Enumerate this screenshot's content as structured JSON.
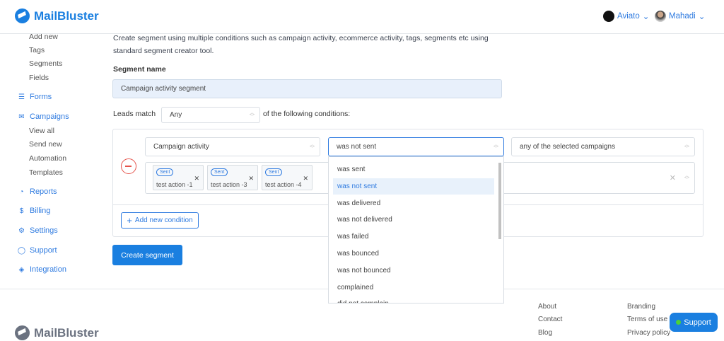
{
  "header": {
    "brand": "MailBluster",
    "accounts": [
      {
        "name": "Aviato"
      },
      {
        "name": "Mahadi"
      }
    ]
  },
  "sidebar": {
    "lead_sub": [
      "Add new",
      "Tags",
      "Segments",
      "Fields"
    ],
    "forms": "Forms",
    "campaigns": {
      "label": "Campaigns",
      "items": [
        "View all",
        "Send new",
        "Automation",
        "Templates"
      ]
    },
    "items": [
      "Reports",
      "Billing",
      "Settings",
      "Support",
      "Integration"
    ]
  },
  "main": {
    "description": "Create segment using multiple conditions such as campaign activity, ecommerce activity, tags, segments etc using standard segment creator tool.",
    "segment_name_label": "Segment name",
    "segment_name_value": "Campaign activity segment",
    "leads_match_label": "Leads match",
    "leads_match_value": "Any",
    "conditions_suffix": "of the following conditions:",
    "condition": {
      "field": "Campaign activity",
      "operator": "was not sent",
      "scope": "any of the selected campaigns",
      "tags": [
        {
          "badge": "Sent",
          "label": "test action -1"
        },
        {
          "badge": "Sent",
          "label": "test action -3"
        },
        {
          "badge": "Sent",
          "label": "test action -4"
        }
      ]
    },
    "operator_options": [
      "was sent",
      "was not sent",
      "was delivered",
      "was not delivered",
      "was failed",
      "was bounced",
      "was not bounced",
      "complained",
      "did not complain"
    ],
    "selected_option": "was not sent",
    "add_condition": "Add new condition",
    "create": "Create segment"
  },
  "footer": {
    "brand": "MailBluster",
    "links_col1": [
      "About",
      "Contact",
      "Blog"
    ],
    "links_col2": [
      "Branding",
      "Terms of use",
      "Privacy policy"
    ],
    "support": "Support"
  },
  "colors": {
    "accent": "#1a7fe0",
    "danger": "#e5534b",
    "online": "#4cd137"
  }
}
